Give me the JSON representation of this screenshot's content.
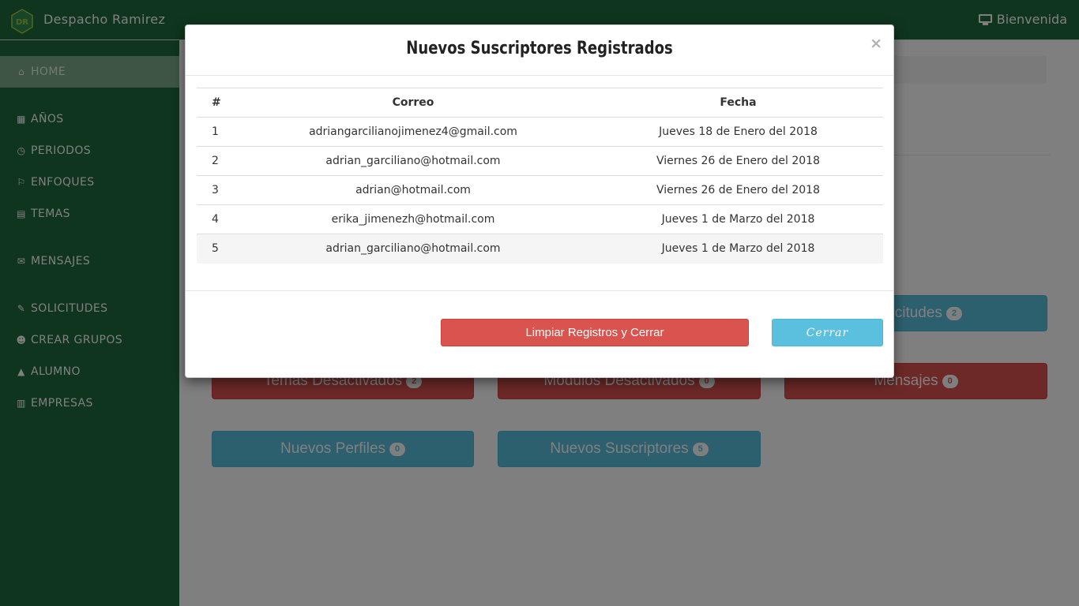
{
  "navbar": {
    "brand_logo_text": "DR",
    "brand_name": "Despacho Ramirez",
    "welcome": "Bienvenida",
    "colors": {
      "green": "#1e6b3d",
      "logo": "#2d8a4e"
    }
  },
  "sidebar": {
    "items": [
      {
        "icon": "home-icon",
        "label": "HOME"
      },
      {
        "icon": "calendar-icon",
        "label": "AÑOS"
      },
      {
        "icon": "clock-icon",
        "label": "PERIODOS"
      },
      {
        "icon": "bookmark-icon",
        "label": "ENFOQUES"
      },
      {
        "icon": "book-icon",
        "label": "TEMAS"
      },
      {
        "icon": "envelope-icon",
        "label": "MENSAJES"
      },
      {
        "icon": "pencil-icon",
        "label": "SOLICITUDES"
      },
      {
        "icon": "users-icon",
        "label": "CREAR GRUPOS"
      },
      {
        "icon": "graduation-cap-icon",
        "label": "ALUMNO"
      },
      {
        "icon": "building-icon",
        "label": "EMPRESAS"
      }
    ]
  },
  "dashboard": {
    "tiles": {
      "solicitudes": {
        "label": "Solicitudes",
        "count": "2"
      },
      "temas_desactivados": {
        "label": "Temas Desactivados",
        "count": "2"
      },
      "modulos_desactivados": {
        "label": "Modulos Desactivados",
        "count": "0"
      },
      "mensajes": {
        "label": "Mensajes",
        "count": "0"
      },
      "nuevos_perfiles": {
        "label": "Nuevos Perfiles",
        "count": "0"
      },
      "nuevos_suscriptores": {
        "label": "Nuevos Suscriptores",
        "count": "5"
      }
    }
  },
  "modal": {
    "title": "Nuevos Suscriptores Registrados",
    "close_symbol": "×",
    "table": {
      "headers": [
        "#",
        "Correo",
        "Fecha"
      ],
      "rows": [
        {
          "num": "1",
          "email": "adriangarcilianojimenez4@gmail.com",
          "date": "Jueves 18 de Enero del 2018"
        },
        {
          "num": "2",
          "email": "adrian_garciliano@hotmail.com",
          "date": "Viernes 26 de Enero del 2018"
        },
        {
          "num": "3",
          "email": "adrian@hotmail.com",
          "date": "Viernes 26 de Enero del 2018"
        },
        {
          "num": "4",
          "email": "erika_jimenezh@hotmail.com",
          "date": "Jueves 1 de Marzo del 2018"
        },
        {
          "num": "5",
          "email": "adrian_garciliano@hotmail.com",
          "date": "Jueves 1 de Marzo del 2018"
        }
      ]
    },
    "clear_button": "Limpiar Registros y Cerrar",
    "close_button": "Cerrar"
  }
}
